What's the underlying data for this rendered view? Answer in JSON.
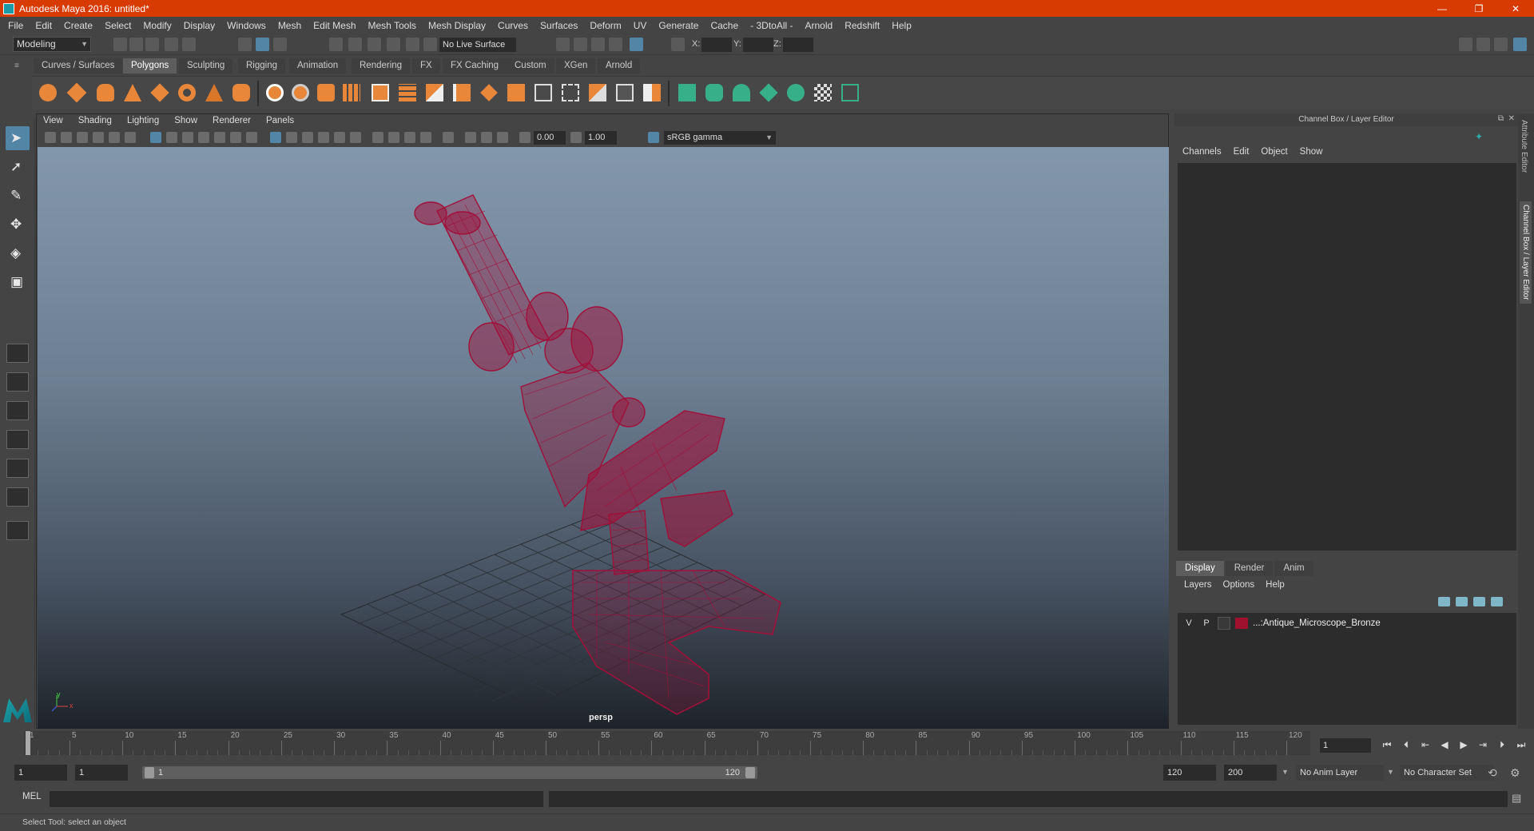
{
  "window": {
    "title": "Autodesk Maya 2016: untitled*",
    "controls": [
      "—",
      "❐",
      "✕"
    ]
  },
  "menubar": [
    "File",
    "Edit",
    "Create",
    "Select",
    "Modify",
    "Display",
    "Windows",
    "Mesh",
    "Edit Mesh",
    "Mesh Tools",
    "Mesh Display",
    "Curves",
    "Surfaces",
    "Deform",
    "UV",
    "Generate",
    "Cache",
    "- 3DtoAll -",
    "Arnold",
    "Redshift",
    "Help"
  ],
  "statusline": {
    "mode": "Modeling",
    "live_surface": "No Live Surface",
    "x_label": "X:",
    "y_label": "Y:",
    "z_label": "Z:"
  },
  "shelf": {
    "tabs": [
      "Curves / Surfaces",
      "Polygons",
      "Sculpting",
      "Rigging",
      "Animation",
      "Rendering",
      "FX",
      "FX Caching",
      "Custom",
      "XGen",
      "Arnold"
    ],
    "active_tab": "Polygons"
  },
  "viewport": {
    "menu": [
      "View",
      "Shading",
      "Lighting",
      "Show",
      "Renderer",
      "Panels"
    ],
    "exposure": "0.00",
    "gamma_value": "1.00",
    "color_space": "sRGB gamma",
    "camera": "persp",
    "axis_y": "y",
    "axis_x": "x",
    "wire_color": "#a0103a"
  },
  "right_panel": {
    "title": "Channel Box / Layer Editor",
    "menu": [
      "Channels",
      "Edit",
      "Object",
      "Show"
    ],
    "layer_tabs": [
      "Display",
      "Render",
      "Anim"
    ],
    "layer_menu": [
      "Layers",
      "Options",
      "Help"
    ],
    "layer": {
      "v": "V",
      "p": "P",
      "name": "...:Antique_Microscope_Bronze",
      "color": "#a0102f"
    },
    "side_tabs": [
      "Attribute Editor",
      "Channel Box / Layer Editor"
    ]
  },
  "timeslider": {
    "ticks": [
      "1",
      "5",
      "10",
      "15",
      "20",
      "25",
      "30",
      "35",
      "40",
      "45",
      "50",
      "55",
      "60",
      "65",
      "70",
      "75",
      "80",
      "85",
      "90",
      "95",
      "100",
      "105",
      "110",
      "115",
      "120"
    ],
    "current_frame": "1"
  },
  "range": {
    "start_field": "1",
    "anim_start": "1",
    "slider_start": "1",
    "slider_end": "120",
    "anim_end": "120",
    "end_field": "200",
    "anim_layer": "No Anim Layer",
    "character_set": "No Character Set"
  },
  "cmdline": {
    "label": "MEL"
  },
  "helpline": {
    "text": "Select Tool: select an object"
  }
}
